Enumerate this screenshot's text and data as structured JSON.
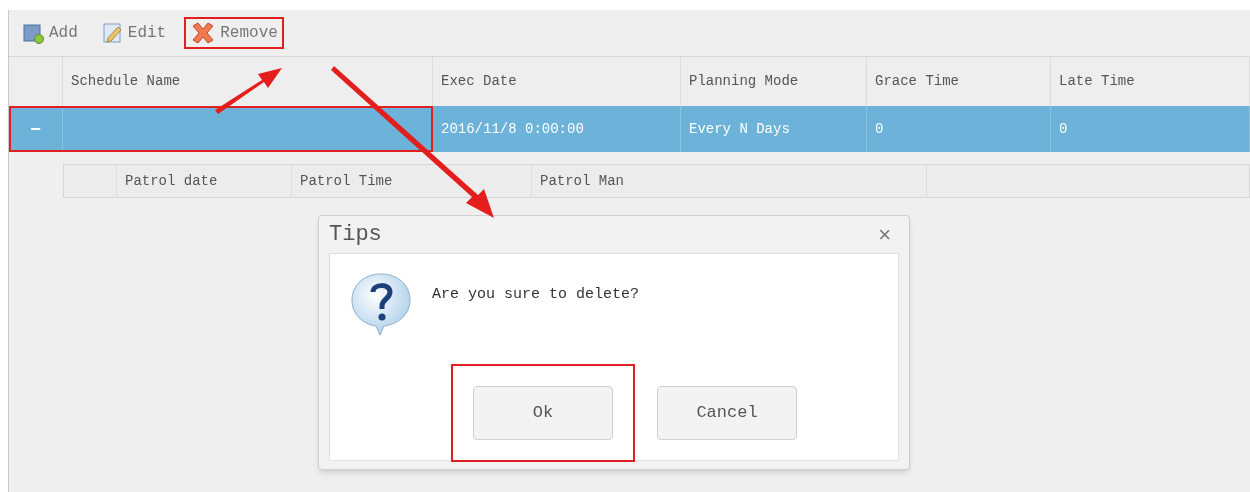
{
  "toolbar": [
    {
      "kind": "add",
      "label": "Add",
      "highlighted": false
    },
    {
      "kind": "edit",
      "label": "Edit",
      "highlighted": false
    },
    {
      "kind": "remove",
      "label": "Remove",
      "highlighted": true
    }
  ],
  "grid": {
    "columns": [
      "Schedule Name",
      "Exec Date",
      "Planning Mode",
      "Grace Time",
      "Late Time"
    ],
    "rows": [
      {
        "expander": "−",
        "expanded": true,
        "selected": true,
        "highlighted": true,
        "cells": [
          "",
          "2016/11/8 0:00:00",
          "Every N Days",
          "0",
          "0"
        ]
      }
    ]
  },
  "subgrid": {
    "columns": [
      "Patrol date",
      "Patrol Time",
      "Patrol Man"
    ]
  },
  "dialog": {
    "title": "Tips",
    "close": "×",
    "message": "Are you sure to delete?",
    "buttons": [
      {
        "label": "Ok",
        "highlighted": true
      },
      {
        "label": "Cancel",
        "highlighted": false
      }
    ]
  }
}
